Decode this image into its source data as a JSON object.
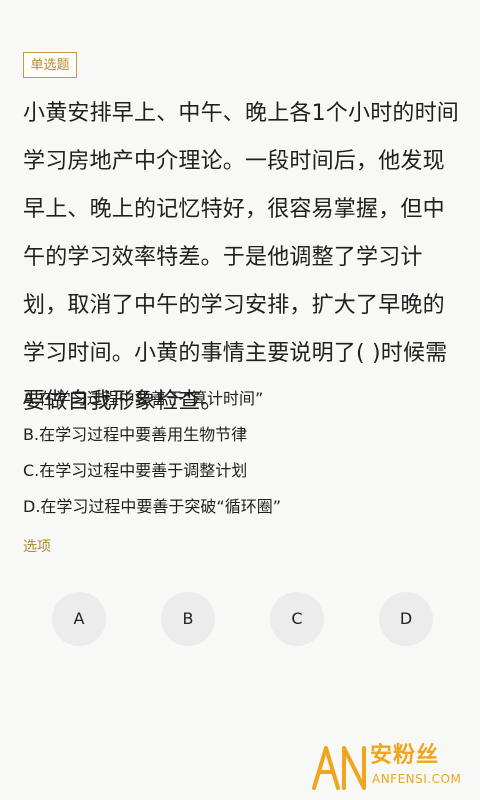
{
  "question_type": "单选题",
  "question_text": "小黄安排早上、中午、晚上各1个小时的时间学习房地产中介理论。一段时间后，他发现早上、晚上的记忆特好，很容易掌握，但中午的学习效率特差。于是他调整了学习计划，取消了中午的学习安排，扩大了早晚的学习时间。小黄的事情主要说明了( )时候需要做自我形象检查。",
  "options": [
    "A.在学习过程中要善于“算计时间”",
    "B.在学习过程中要善用生物节律",
    "C.在学习过程中要善于调整计划",
    "D.在学习过程中要善于突破“循环圈”"
  ],
  "section_label": "选项",
  "answers": [
    "A",
    "B",
    "C",
    "D"
  ],
  "watermark": {
    "logo": "AN",
    "title": "安粉丝",
    "subtitle": "ANFENSI.COM"
  },
  "colors": {
    "accent": "#b48a33",
    "watermark": "#f0a51f",
    "answer_bg": "#ececec",
    "background": "#f8f8f6"
  }
}
